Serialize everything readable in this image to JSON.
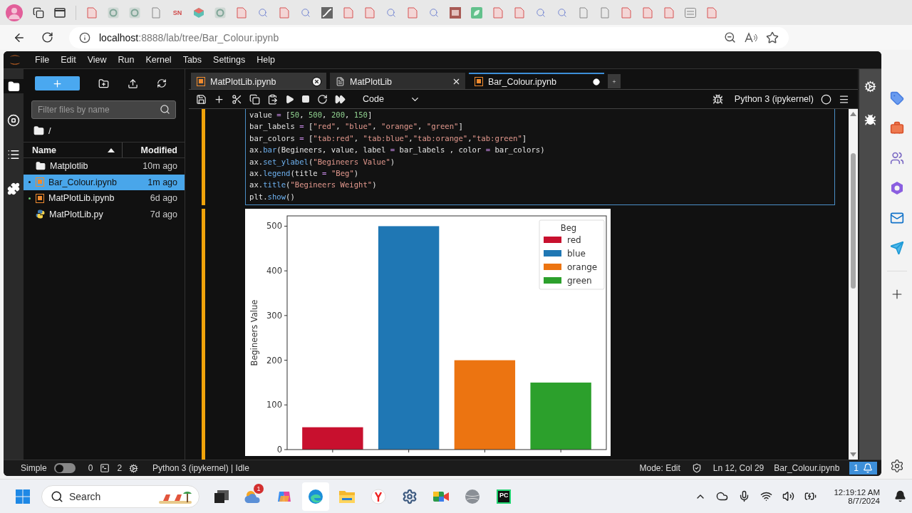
{
  "browser": {
    "favicons": [
      {
        "kind": "pdf"
      },
      {
        "kind": "ring"
      },
      {
        "kind": "ring"
      },
      {
        "kind": "page"
      },
      {
        "kind": "text",
        "label": "SN"
      },
      {
        "kind": "cube"
      },
      {
        "kind": "ring"
      },
      {
        "kind": "pdf"
      },
      {
        "kind": "search"
      },
      {
        "kind": "pdf"
      },
      {
        "kind": "search"
      },
      {
        "kind": "chart"
      },
      {
        "kind": "pdf"
      },
      {
        "kind": "pdf"
      },
      {
        "kind": "search"
      },
      {
        "kind": "pdf"
      },
      {
        "kind": "search"
      },
      {
        "kind": "fax"
      },
      {
        "kind": "leaf"
      },
      {
        "kind": "pdf"
      },
      {
        "kind": "pdf"
      },
      {
        "kind": "search"
      },
      {
        "kind": "search"
      },
      {
        "kind": "page"
      },
      {
        "kind": "page"
      },
      {
        "kind": "pdf"
      },
      {
        "kind": "pdf"
      },
      {
        "kind": "pdf"
      },
      {
        "kind": "grid"
      },
      {
        "kind": "pdf"
      }
    ],
    "address": {
      "host": "localhost",
      "path": ":8888/lab/tree/Bar_Colour.ipynb"
    }
  },
  "menu": [
    "File",
    "Edit",
    "View",
    "Run",
    "Kernel",
    "Tabs",
    "Settings",
    "Help"
  ],
  "file_browser": {
    "filter": {
      "placeholder": "Filter files by name"
    },
    "path": "/",
    "columns": [
      {
        "label": "Name",
        "sorted": true
      },
      {
        "label": "Modified",
        "sorted": false
      }
    ],
    "rows": [
      {
        "kind": "folder",
        "name": "Matplotlib",
        "modified": "10m ago",
        "selected": false,
        "running": false
      },
      {
        "kind": "notebook",
        "name": "Bar_Colour.ipynb",
        "modified": "1m ago",
        "selected": true,
        "running": true
      },
      {
        "kind": "notebook",
        "name": "MatPlotLib.ipynb",
        "modified": "6d ago",
        "selected": false,
        "running": true
      },
      {
        "kind": "python",
        "name": "MatPlotLib.py",
        "modified": "7d ago",
        "selected": false,
        "running": false
      }
    ]
  },
  "tabs": [
    {
      "kind": "notebook",
      "label": "MatPlotLib.ipynb",
      "selected": false,
      "dirty": false,
      "hovered": true
    },
    {
      "kind": "text",
      "label": "MatPlotLib",
      "selected": false,
      "dirty": false,
      "hovered": false
    },
    {
      "kind": "notebook",
      "label": "Bar_Colour.ipynb",
      "selected": true,
      "dirty": true,
      "hovered": false
    }
  ],
  "toolbar": {
    "cell_type": "Code",
    "kernel": "Python 3 (ipykernel)",
    "kernel_busy": false
  },
  "cells": [
    {
      "kind": "code",
      "selected": true,
      "editing": true,
      "lines": [
        "value = [50, 500, 200, 150]",
        "bar_labels = [\"red\", \"blue\", \"orange\", \"green\"]",
        "bar_colors = [\"tab:red\", \"tab:blue\",\"tab:orange\",\"tab:green\"]",
        "ax.bar(Begineers, value, label = bar_labels , color = bar_colors)",
        "ax.set_ylabel(\"Begineers Value\")",
        "ax.legend(title = \"Beg\")",
        "ax.title(\"Begineers Weight\")",
        "plt.show()"
      ]
    },
    {
      "kind": "output",
      "selected": true,
      "chart_data": {
        "type": "bar",
        "ylabel": "Begineers Value",
        "ylim": [
          0,
          523
        ],
        "yticks": [
          {
            "value": 0,
            "label": "0"
          },
          {
            "value": 100,
            "label": "100"
          },
          {
            "value": 200,
            "label": "200"
          },
          {
            "value": 300,
            "label": "300"
          },
          {
            "value": 400,
            "label": "400"
          },
          {
            "value": 500,
            "label": "500"
          }
        ],
        "categories": [
          null,
          null,
          null,
          null
        ],
        "stacked": true,
        "series": [
          {
            "name": "red",
            "color": "#c8102e",
            "values": [
              50,
              null,
              null,
              null
            ]
          },
          {
            "name": "blue",
            "color": "#1f77b4",
            "values": [
              null,
              500,
              null,
              null
            ]
          },
          {
            "name": "orange",
            "color": "#ec7411",
            "values": [
              null,
              null,
              200,
              null
            ]
          },
          {
            "name": "green",
            "color": "#2ca02c",
            "values": [
              null,
              null,
              null,
              150
            ]
          }
        ],
        "legend": {
          "title": "Beg"
        }
      }
    }
  ],
  "status_bar": {
    "simple_label": "Simple",
    "simple_mode": false,
    "terminals": "0",
    "kernels": "2",
    "kernel_status": "Python 3 (ipykernel) | Idle",
    "mode": "Mode: Edit",
    "position": "Ln 12, Col 29",
    "file": "Bar_Colour.ipynb",
    "notifications": "1"
  },
  "taskbar": {
    "search": {
      "placeholder": "Search"
    },
    "apps": [
      {
        "kind": "taskview",
        "selected": false
      },
      {
        "kind": "weather",
        "badge": "1",
        "selected": false
      },
      {
        "kind": "copilot",
        "selected": false
      },
      {
        "kind": "edge",
        "selected": true
      },
      {
        "kind": "explorer",
        "selected": false
      },
      {
        "kind": "yandex",
        "selected": false
      },
      {
        "kind": "settings",
        "selected": false
      },
      {
        "kind": "meet",
        "selected": false
      },
      {
        "kind": "globe",
        "selected": false
      },
      {
        "kind": "pycharm",
        "label": "PC",
        "selected": false
      }
    ],
    "time": "12:19:12 AM",
    "date": "8/7/2024"
  }
}
